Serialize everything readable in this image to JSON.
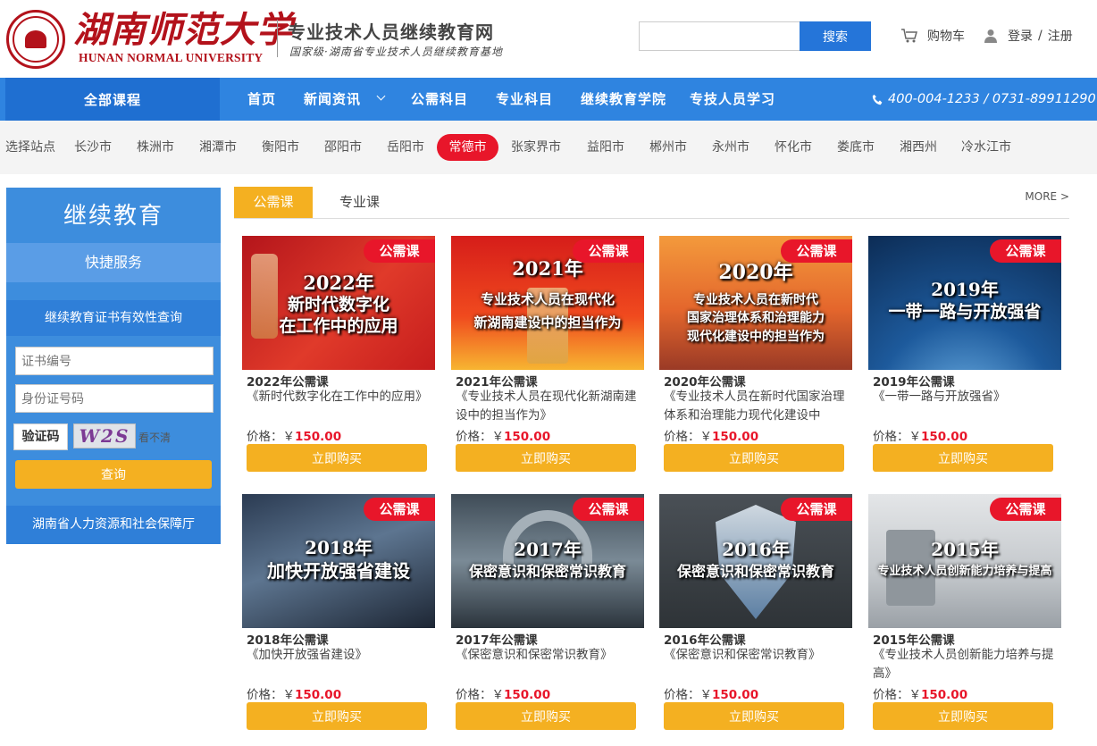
{
  "header": {
    "logo_cn": "湖南师范大学",
    "logo_en": "HUNAN NORMAL UNIVERSITY",
    "site_name": "专业技术人员继续教育网",
    "site_subtitle": "国家级·湖南省专业技术人员继续教育基地",
    "search_button": "搜索",
    "cart": "购物车",
    "login": "登录",
    "separator": "/",
    "register": "注册"
  },
  "nav": {
    "all_courses": "全部课程",
    "items": [
      "首页",
      "新闻资讯",
      "公需科目",
      "专业科目",
      "继续教育学院",
      "专技人员学习"
    ],
    "phone": "400-004-1233 / 0731-89911290"
  },
  "stations": {
    "label": "选择站点",
    "items": [
      "长沙市",
      "株洲市",
      "湘潭市",
      "衡阳市",
      "邵阳市",
      "岳阳市",
      "常德市",
      "张家界市",
      "益阳市",
      "郴州市",
      "永州市",
      "怀化市",
      "娄底市",
      "湘西州",
      "冷水江市"
    ],
    "active": "常德市"
  },
  "sidebar": {
    "title": "继续教育",
    "quick_service": "快捷服务",
    "verify_title": "继续教育证书有效性查询",
    "cert_placeholder": "证书编号",
    "id_placeholder": "身份证号码",
    "captcha_label": "验证码",
    "captcha_text": "W2S",
    "captcha_refresh": "看不清",
    "query_button": "查询",
    "footer": "湖南省人力资源和社会保障厅"
  },
  "tabs": {
    "active": "公需课",
    "inactive": "专业课",
    "more": "MORE >"
  },
  "courses": [
    {
      "tag": "公需课",
      "thumb_year": "2022年",
      "thumb_title": "新时代数字化\n在工作中的应用",
      "year_label": "2022年公需课",
      "desc": "《新时代数字化在工作中的应用》",
      "price_label": "价格：￥",
      "price": "150.00",
      "buy": "立即购买"
    },
    {
      "tag": "公需课",
      "thumb_year": "2021年",
      "thumb_title": "专业技术人员在现代化\n新湖南建设中的担当作为",
      "year_label": "2021年公需课",
      "desc": "《专业技术人员在现代化新湖南建设中的担当作为》",
      "price_label": "价格：￥",
      "price": "150.00",
      "buy": "立即购买"
    },
    {
      "tag": "公需课",
      "thumb_year": "2020年",
      "thumb_title": "专业技术人员在新时代\n国家治理体系和治理能力\n现代化建设中的担当作为",
      "year_label": "2020年公需课",
      "desc": "《专业技术人员在新时代国家治理体系和治理能力现代化建设中",
      "price_label": "价格：￥",
      "price": "150.00",
      "buy": "立即购买"
    },
    {
      "tag": "公需课",
      "thumb_year": "2019年",
      "thumb_title": "一带一路与开放强省",
      "year_label": "2019年公需课",
      "desc": "《一带一路与开放强省》",
      "price_label": "价格：￥",
      "price": "150.00",
      "buy": "立即购买"
    },
    {
      "tag": "公需课",
      "thumb_year": "2018年",
      "thumb_title": "加快开放强省建设",
      "year_label": "2018年公需课",
      "desc": "《加快开放强省建设》",
      "price_label": "价格：￥",
      "price": "150.00",
      "buy": "立即购买"
    },
    {
      "tag": "公需课",
      "thumb_year": "2017年",
      "thumb_title": "保密意识和保密常识教育",
      "year_label": "2017年公需课",
      "desc": "《保密意识和保密常识教育》",
      "price_label": "价格：￥",
      "price": "150.00",
      "buy": "立即购买"
    },
    {
      "tag": "公需课",
      "thumb_year": "2016年",
      "thumb_title": "保密意识和保密常识教育",
      "year_label": "2016年公需课",
      "desc": "《保密意识和保密常识教育》",
      "price_label": "价格：￥",
      "price": "150.00",
      "buy": "立即购买"
    },
    {
      "tag": "公需课",
      "thumb_year": "2015年",
      "thumb_title": "专业技术人员创新能力培养与提高",
      "year_label": "2015年公需课",
      "desc": "《专业技术人员创新能力培养与提高》",
      "price_label": "价格：￥",
      "price": "150.00",
      "buy": "立即购买"
    }
  ],
  "colors": {
    "nav_blue": "#2f84e0",
    "accent_orange": "#f4b021",
    "brand_red": "#b3121b",
    "tag_red": "#e8162a"
  }
}
